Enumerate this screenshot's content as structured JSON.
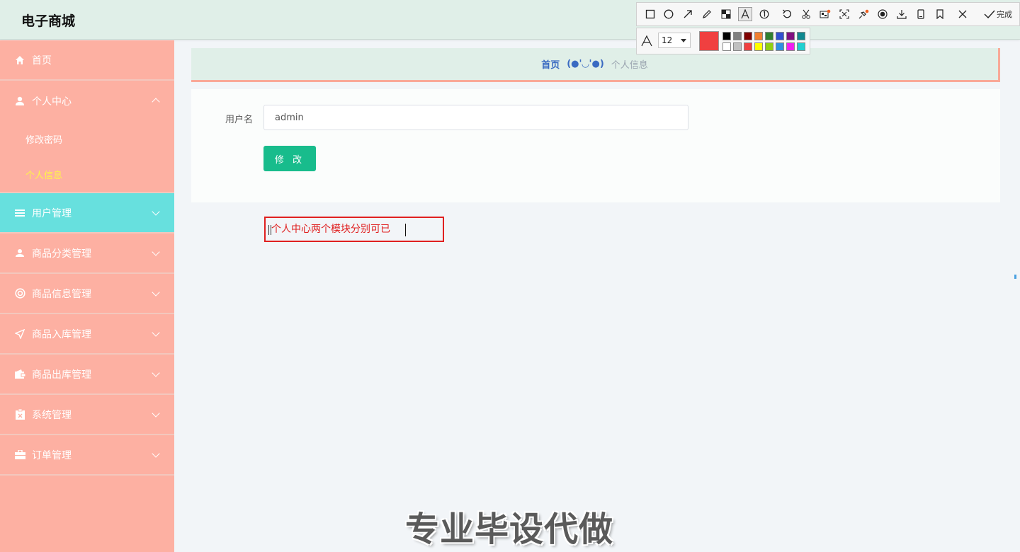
{
  "header": {
    "brand": "电子商城"
  },
  "sidebar": {
    "items": [
      {
        "label": "首页",
        "icon": "home-icon"
      },
      {
        "label": "个人中心",
        "icon": "user-icon",
        "expanded": true,
        "children": [
          {
            "label": "修改密码"
          },
          {
            "label": "个人信息",
            "current": true
          }
        ]
      },
      {
        "label": "用户管理",
        "icon": "list-icon",
        "active": true
      },
      {
        "label": "商品分类管理",
        "icon": "person-icon"
      },
      {
        "label": "商品信息管理",
        "icon": "lifebuoy-icon"
      },
      {
        "label": "商品入库管理",
        "icon": "send-icon"
      },
      {
        "label": "商品出库管理",
        "icon": "wallet-icon"
      },
      {
        "label": "系统管理",
        "icon": "clipboard-icon"
      },
      {
        "label": "订单管理",
        "icon": "briefcase-icon"
      }
    ],
    "colors": {
      "bg": "#fdb0a2",
      "active": "#67e0de",
      "current_text": "#fff34a"
    }
  },
  "breadcrumb": {
    "home": "首页",
    "separator": "(●'◡'●)",
    "current": "个人信息"
  },
  "form": {
    "username_label": "用户名",
    "username_value": "admin",
    "submit_label": "修 改",
    "submit_color": "#18bc8c"
  },
  "annotation": {
    "text": "个人中心两个模块分别可已",
    "color": "#e02020"
  },
  "screenshot_toolbar": {
    "tools": [
      "rectangle-icon",
      "ellipse-icon",
      "arrow-icon",
      "pencil-icon",
      "mosaic-icon",
      "text-icon",
      "number-icon",
      "undo-icon",
      "cut-icon",
      "ocr-icon",
      "scan-icon",
      "pin-icon",
      "record-icon",
      "download-icon",
      "phone-icon",
      "bookmark-icon",
      "close-icon"
    ],
    "done_label": "完成",
    "font_size": "12",
    "selected_color": "#f04040",
    "palette_top": [
      "#000000",
      "#808080",
      "#800000",
      "#f08030",
      "#308030",
      "#3050d0",
      "#801080",
      "#108890"
    ],
    "palette_bottom": [
      "#ffffff",
      "#c0c0c0",
      "#f04040",
      "#ffff00",
      "#90d010",
      "#3090e0",
      "#f020f0",
      "#20d0d0"
    ]
  },
  "watermark": {
    "text": "专业毕设代做"
  }
}
